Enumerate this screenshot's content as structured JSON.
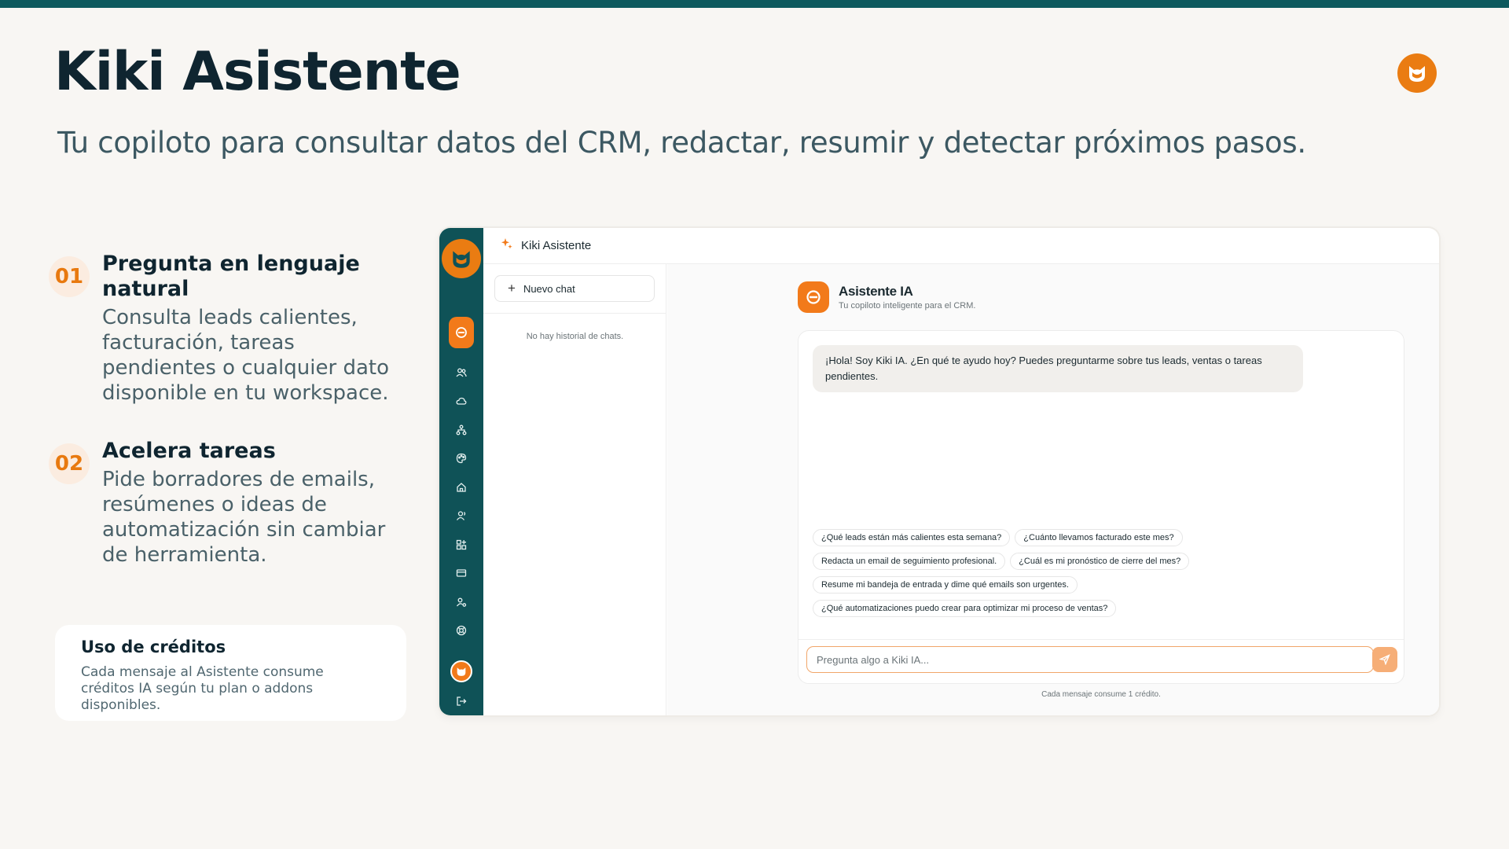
{
  "colors": {
    "accent": "#ea7c12",
    "rail": "#0f5257",
    "topbar": "#0e5a5e"
  },
  "header": {
    "title": "Kiki Asistente",
    "subtitle": "Tu copiloto para consultar datos del CRM, redactar, resumir y detectar próximos pasos.",
    "logo_icon": "kiki-cat-logo-icon"
  },
  "features": [
    {
      "number": "01",
      "title": "Pregunta en lenguaje natural",
      "description": "Consulta leads calientes, facturación, tareas pendientes o cualquier dato disponible en tu workspace."
    },
    {
      "number": "02",
      "title": "Acelera tareas",
      "description": "Pide borradores de emails, resúmenes o ideas de automatización sin cambiar de herramienta."
    }
  ],
  "credits_card": {
    "title": "Uso de créditos",
    "text": "Cada mensaje al Asistente consume créditos IA según tu plan o addons disponibles."
  },
  "app": {
    "header_title": "Kiki Asistente",
    "header_icon": "sparkles-icon",
    "rail_icons": [
      "assistant-icon",
      "users-icon",
      "cloud-icon",
      "hierarchy-icon",
      "palette-icon",
      "home-icon",
      "contacts-icon",
      "apps-icon",
      "card-icon",
      "user-settings-icon",
      "support-icon",
      "logout-icon"
    ],
    "new_chat_label": "Nuevo chat",
    "no_history": "No hay historial de chats.",
    "assistant_name": "Asistente IA",
    "assistant_tagline": "Tu copiloto inteligente para el CRM.",
    "greeting": "¡Hola! Soy Kiki IA. ¿En qué te ayudo hoy? Puedes preguntarme sobre tus leads, ventas o tareas pendientes.",
    "suggestions": [
      "¿Qué leads están más calientes esta semana?",
      "¿Cuánto llevamos facturado este mes?",
      "Redacta un email de seguimiento profesional.",
      "¿Cuál es mi pronóstico de cierre del mes?",
      "Resume mi bandeja de entrada y dime qué emails son urgentes.",
      "¿Qué automatizaciones puedo crear para optimizar mi proceso de ventas?"
    ],
    "input_placeholder": "Pregunta algo a Kiki IA...",
    "footnote": "Cada mensaje consume 1 crédito."
  }
}
